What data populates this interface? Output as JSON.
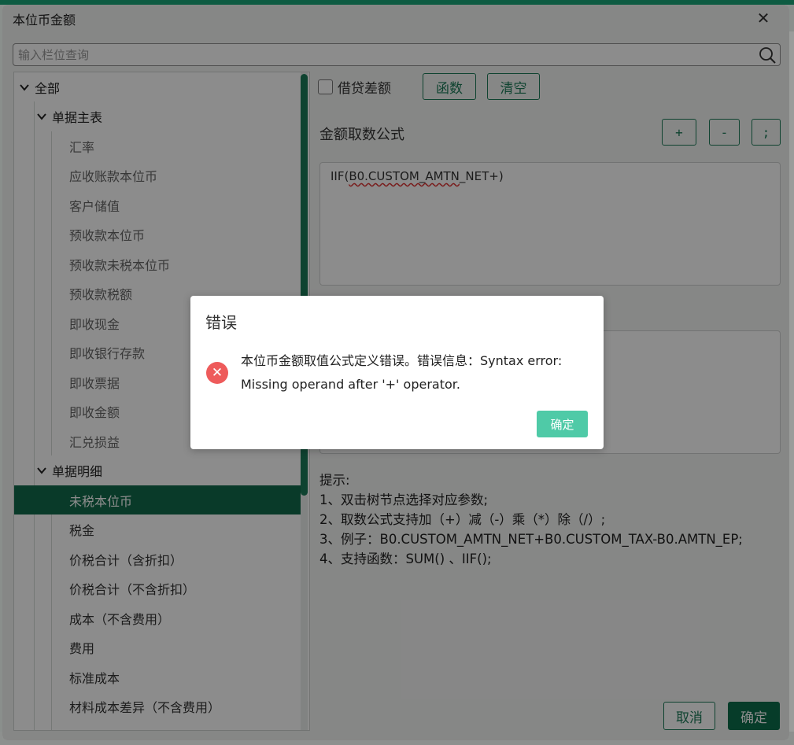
{
  "window": {
    "title": "本位币金额"
  },
  "search": {
    "placeholder": "输入栏位查询"
  },
  "tree": {
    "root": "全部",
    "group1": "单据主表",
    "group1_items": [
      "汇率",
      "应收账款本位币",
      "客户储值",
      "预收款本位币",
      "预收款未税本位币",
      "预收款税额",
      "即收现金",
      "即收银行存款",
      "即收票据",
      "即收金额",
      "汇兑损益"
    ],
    "group2": "单据明细",
    "group2_items": [
      "未税本位币",
      "税金",
      "价税合计（含折扣）",
      "价税合计（不含折扣）",
      "成本（不含费用）",
      "费用",
      "标准成本",
      "材料成本差异（不含费用）"
    ],
    "selected": "未税本位币"
  },
  "toolbar": {
    "debit_credit_label": "借贷差额",
    "function_button": "函数",
    "clear_button": "清空"
  },
  "formula": {
    "section_label": "金额取数公式",
    "plus": "+",
    "minus": "-",
    "semicolon": ";",
    "prefix": "IIF(",
    "squiggle": "B0.CUSTOM_AMTN",
    "suffix": "_NET+)"
  },
  "tips": {
    "title": "提示:",
    "lines": [
      "1、双击树节点选择对应参数;",
      "2、取数公式支持加（+）减（-）乘（*）除（/）;",
      "3、例子：B0.CUSTOM_AMTN_NET+B0.CUSTOM_TAX-B0.AMTN_EP;",
      "4、支持函数：SUM() 、IIF();"
    ]
  },
  "footer": {
    "cancel": "取消",
    "confirm": "确定"
  },
  "error_modal": {
    "title": "错误",
    "message": "本位币金额取值公式定义错误。错误信息：Syntax error: Missing operand after '+' operator.",
    "ok": "确定"
  },
  "colors": {
    "accent": "#116b4c",
    "error": "#ee5b5b",
    "modal_ok": "#4fcaa7"
  }
}
